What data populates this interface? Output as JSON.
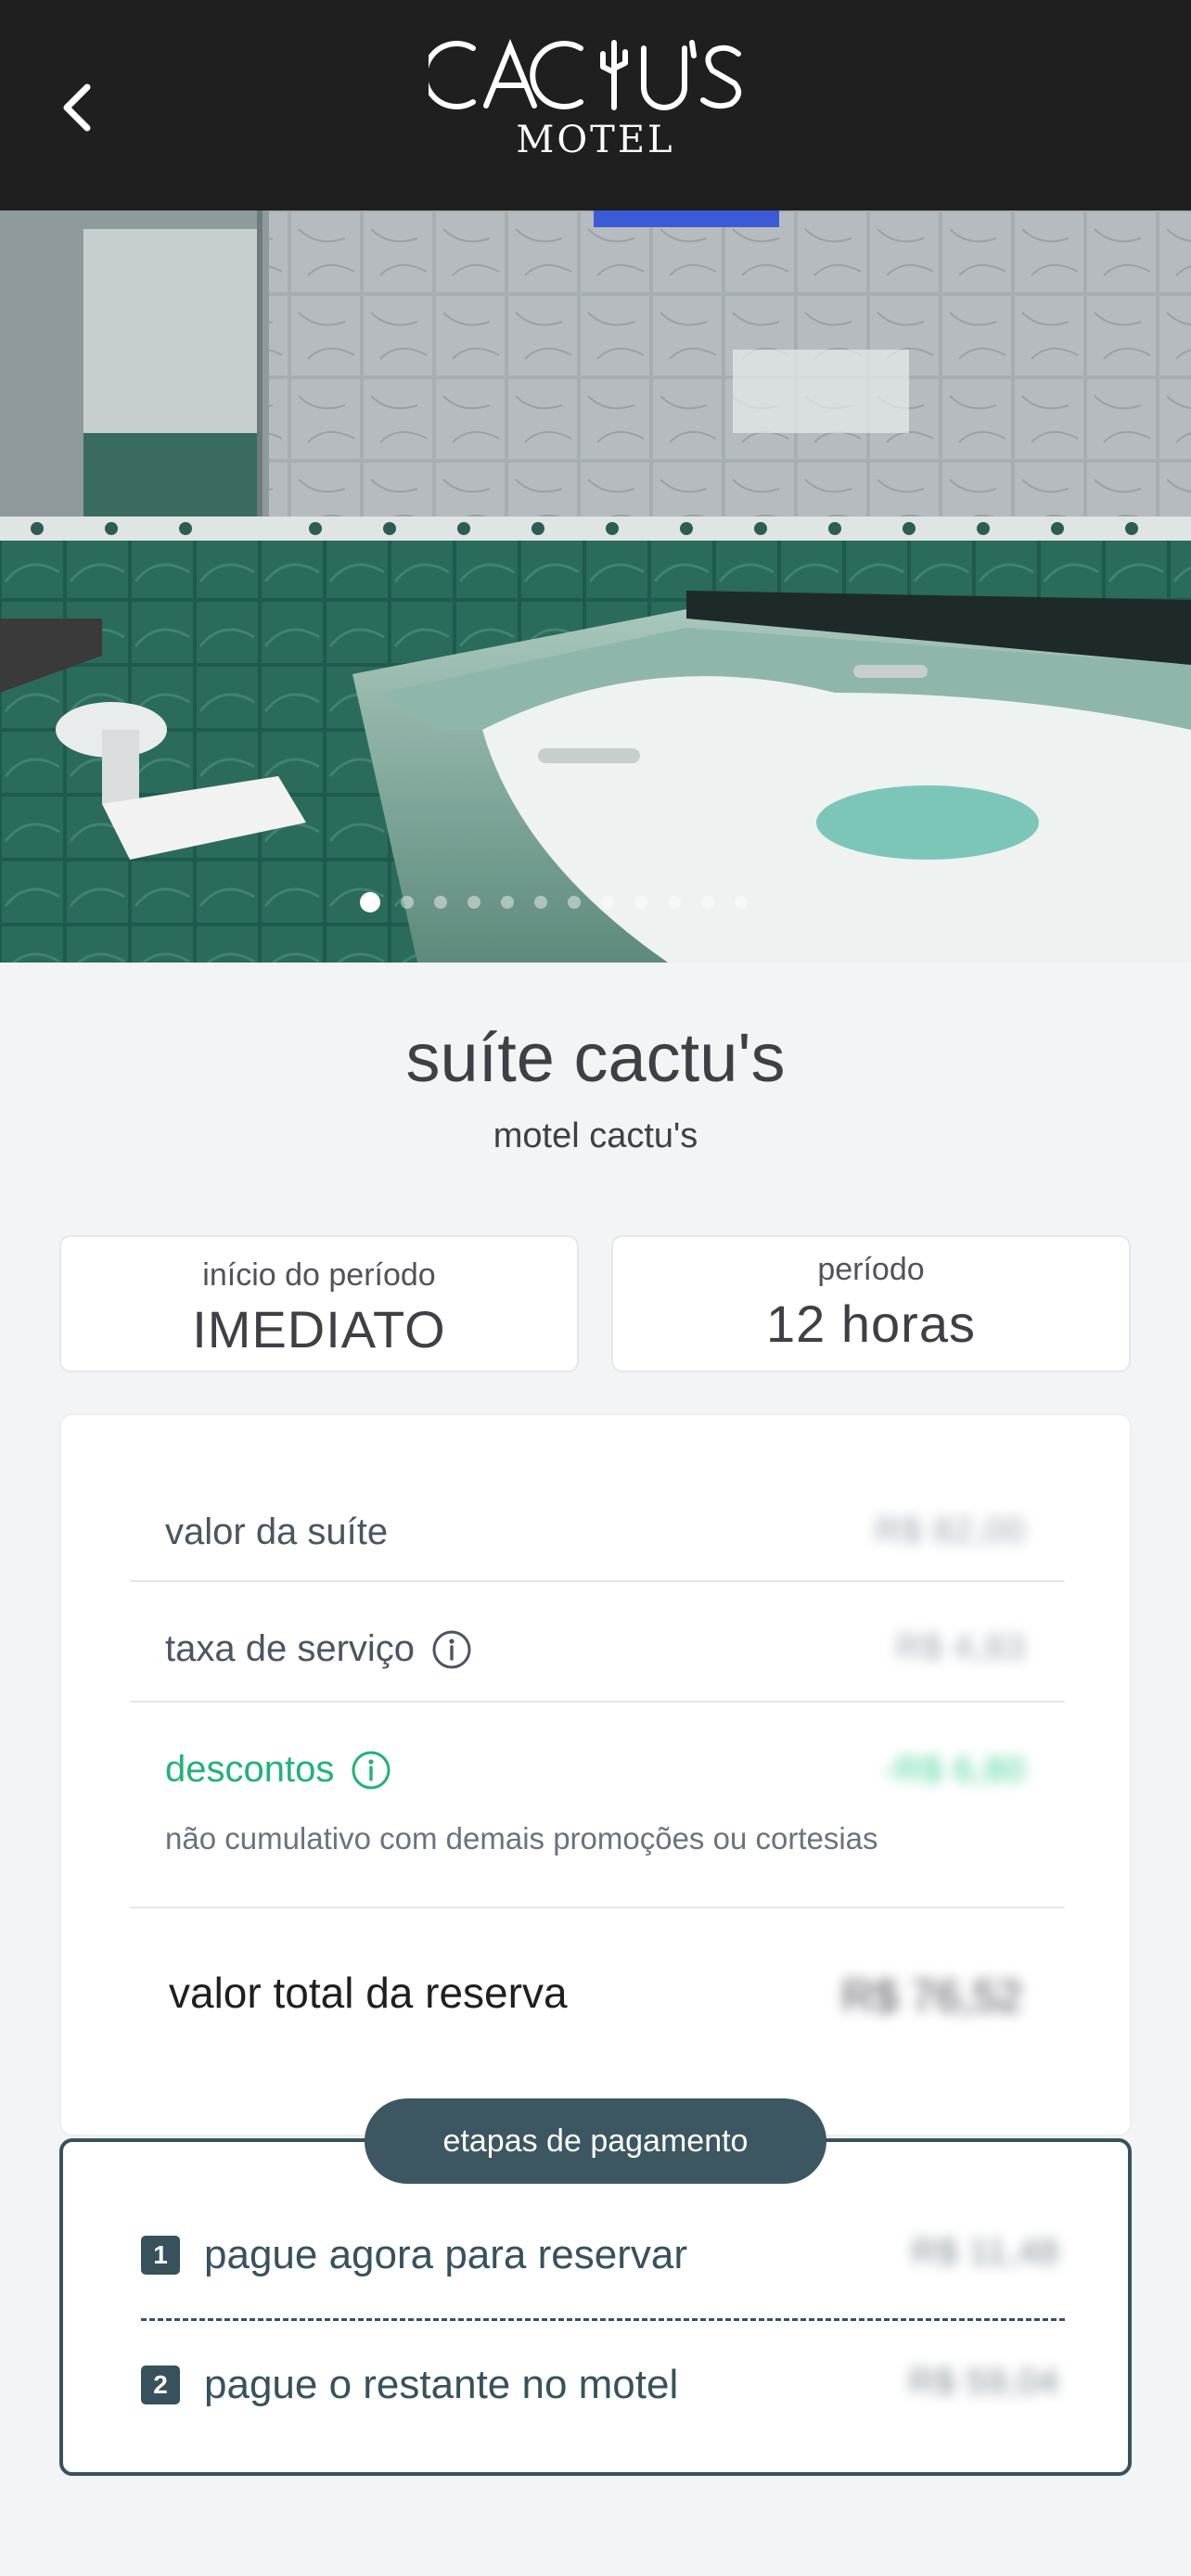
{
  "header": {
    "brand_main": "CACTUS",
    "brand_sub": "MOTEL",
    "back_icon": "chevron-left-icon"
  },
  "gallery": {
    "total_slides": 12,
    "active_slide": 1
  },
  "suite": {
    "title": "suíte cactu's",
    "motel": "motel cactu's"
  },
  "info": {
    "start_label": "início do período",
    "start_value": "IMEDIATO",
    "period_label": "período",
    "period_value": "12 horas"
  },
  "pricing": {
    "suite_label": "valor da suíte",
    "suite_value": "R$ 82,00",
    "tax_label": "taxa de serviço",
    "tax_value": "R$ 4,83",
    "discount_label": "descontos",
    "discount_value": "-R$ 6,80",
    "discount_note": "não cumulativo com demais promoções ou cortesias",
    "total_label": "valor total da reserva",
    "total_value": "R$ 76,52"
  },
  "steps": {
    "title": "etapas de pagamento",
    "step1_num": "1",
    "step1_label": "pague agora para reservar",
    "step1_value": "R$ 11,48",
    "step2_num": "2",
    "step2_label": "pague o restante no motel",
    "step2_value": "R$ 59,04"
  },
  "colors": {
    "header_bg": "#1f1f1f",
    "discount_green": "#22b17a",
    "steps_accent": "#37525c"
  }
}
